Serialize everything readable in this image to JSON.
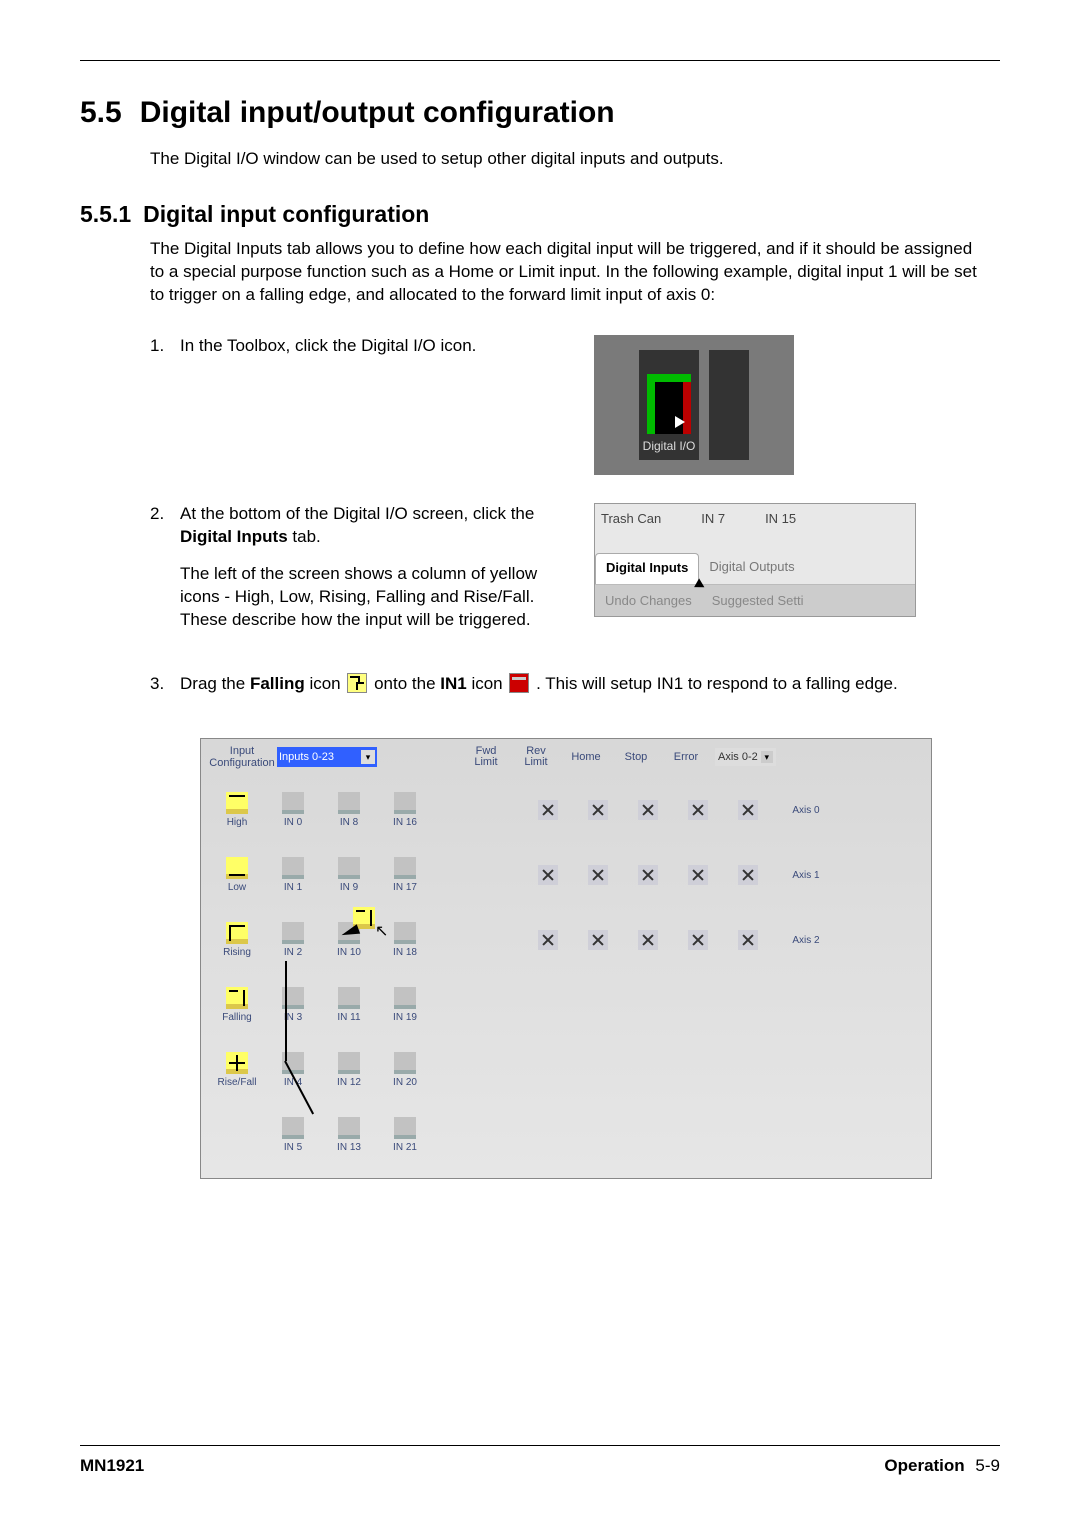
{
  "section": {
    "number": "5.5",
    "title": "Digital input/output configuration",
    "intro": "The Digital I/O window can be used to setup other digital inputs and outputs."
  },
  "subsection": {
    "number": "5.5.1",
    "title": "Digital input configuration",
    "body": "The Digital Inputs tab allows you to define how each digital input will be triggered, and if it should be assigned to a special purpose function such as a Home or Limit input.  In the following example, digital input 1 will be set to trigger on a falling edge, and allocated to the forward limit input of axis 0:"
  },
  "steps": {
    "s1": {
      "num": "1.",
      "text": "In the Toolbox, click the Digital I/O icon."
    },
    "s2": {
      "num": "2.",
      "p1a": "At the bottom of the Digital I/O screen, click the ",
      "p1b": "Digital Inputs",
      "p1c": " tab.",
      "p2": "The left of the screen shows a column of yellow icons - High, Low, Rising, Falling and Rise/Fall. These describe how the input will be triggered."
    },
    "s3": {
      "num": "3.",
      "t1": "Drag the ",
      "t2": "Falling",
      "t3": " icon ",
      "t4": " onto the ",
      "t5": "IN1",
      "t6": " icon ",
      "t7": " . This will setup IN1 to respond to a falling edge."
    }
  },
  "toolbox_img": {
    "label": "Digital I/O"
  },
  "tabs_img": {
    "top": {
      "trash": "Trash Can",
      "in7": "IN 7",
      "in15": "IN 15"
    },
    "tabs": {
      "di": "Digital Inputs",
      "do": "Digital Outputs"
    },
    "bottom": {
      "undo": "Undo Changes",
      "sugg": "Suggested Setti"
    }
  },
  "grid": {
    "header": {
      "left1": "Input",
      "left2": "Configuration",
      "dd": "Inputs 0-23",
      "cols": {
        "fwd1": "Fwd",
        "fwd2": "Limit",
        "rev1": "Rev",
        "rev2": "Limit",
        "home": "Home",
        "stop": "Stop",
        "error": "Error"
      },
      "right": "Axis 0-2"
    },
    "types": {
      "high": "High",
      "low": "Low",
      "rising": "Rising",
      "falling": "Falling",
      "risefall": "Rise/Fall"
    },
    "row0": {
      "a": "IN 0",
      "b": "IN 8",
      "c": "IN 16",
      "axis": "Axis 0"
    },
    "row1": {
      "a": "IN 1",
      "b": "IN 9",
      "c": "IN 17",
      "axis": "Axis 1"
    },
    "row2": {
      "a": "IN 2",
      "b": "IN 10",
      "c": "IN 18",
      "axis": "Axis 2"
    },
    "row3": {
      "a": "IN 3",
      "b": "IN 11",
      "c": "IN 19"
    },
    "row4": {
      "a": "IN 4",
      "b": "IN 12",
      "c": "IN 20"
    },
    "row5": {
      "a": "IN 5",
      "b": "IN 13",
      "c": "IN 21"
    }
  },
  "footer": {
    "left": "MN1921",
    "right_a": "Operation",
    "right_b": "5-9"
  }
}
